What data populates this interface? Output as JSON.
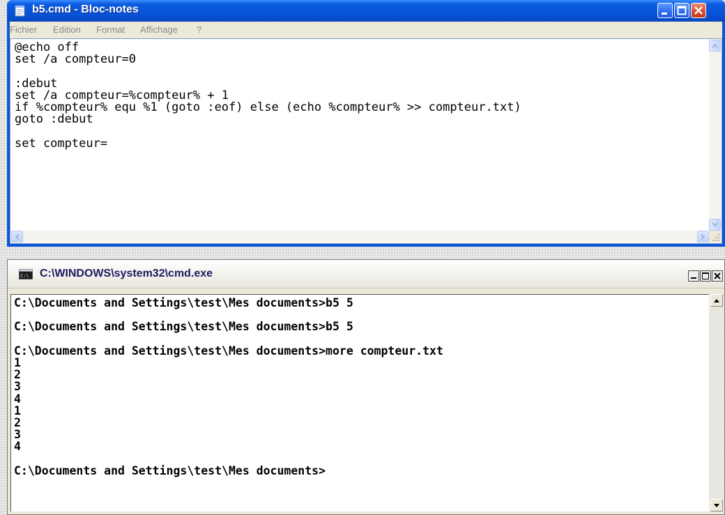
{
  "notepad": {
    "title": "b5.cmd - Bloc-notes",
    "menu": [
      "Fichier",
      "Edition",
      "Format",
      "Affichage",
      "?"
    ],
    "content": "@echo off\nset /a compteur=0\n\n:debut\nset /a compteur=%compteur% + 1\nif %compteur% equ %1 (goto :eof) else (echo %compteur% >> compteur.txt)\ngoto :debut\n\nset compteur="
  },
  "console": {
    "title": "C:\\WINDOWS\\system32\\cmd.exe",
    "output": "C:\\Documents and Settings\\test\\Mes documents>b5 5\n\nC:\\Documents and Settings\\test\\Mes documents>b5 5\n\nC:\\Documents and Settings\\test\\Mes documents>more compteur.txt\n1\n2\n3\n4\n1\n2\n3\n4\n\nC:\\Documents and Settings\\test\\Mes documents>"
  },
  "icons": {
    "notepad": "notepad-icon",
    "console": "console-icon",
    "minimize": "minimize-icon",
    "maximize": "maximize-icon",
    "close": "close-icon",
    "scroll_up": "arrow-up-icon",
    "scroll_down": "arrow-down-icon",
    "scroll_left": "arrow-left-icon",
    "scroll_right": "arrow-right-icon",
    "resize_grip": "resize-grip-icon"
  },
  "colors": {
    "xp_title_blue": "#0a5be0",
    "close_red": "#d8492a",
    "window_face": "#ece9d8"
  }
}
